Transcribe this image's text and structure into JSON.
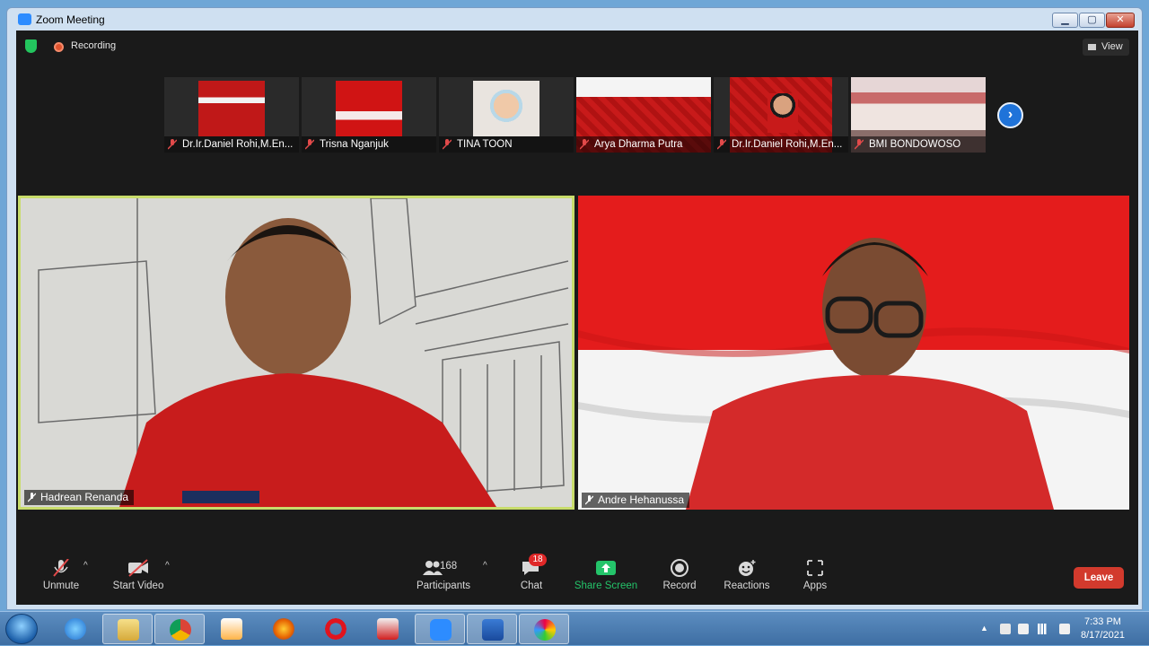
{
  "window": {
    "title": "Zoom Meeting"
  },
  "status": {
    "recording_label": "Recording",
    "view_label": "View"
  },
  "thumbnails": [
    {
      "name": "Dr.Ir.Daniel Rohi,M.En..."
    },
    {
      "name": "Trisna Nganjuk"
    },
    {
      "name": "TINA TOON"
    },
    {
      "name": "Arya Dharma Putra"
    },
    {
      "name": "Dr.Ir.Daniel Rohi,M.En..."
    },
    {
      "name": "BMI BONDOWOSO"
    }
  ],
  "videos": {
    "left_name": "Hadrean Renanda",
    "right_name": "Andre Hehanussa"
  },
  "toolbar": {
    "unmute": "Unmute",
    "start_video": "Start Video",
    "participants": "Participants",
    "participants_count": "168",
    "chat": "Chat",
    "chat_badge": "18",
    "share_screen": "Share Screen",
    "record": "Record",
    "reactions": "Reactions",
    "apps": "Apps",
    "leave": "Leave"
  },
  "taskbar": {
    "time": "7:33 PM",
    "date": "8/17/2021"
  },
  "colors": {
    "share_green": "#24c46a",
    "leave_red": "#d23a2d",
    "active_speaker_border": "#c8dc6b",
    "zoom_blue": "#2d8cff"
  },
  "icons": [
    "shield-icon",
    "recording-icon",
    "view-icon",
    "mic-muted-icon",
    "video-off-icon",
    "participants-icon",
    "chat-icon",
    "share-screen-icon",
    "record-icon",
    "reactions-icon",
    "apps-icon",
    "next-page-icon"
  ]
}
